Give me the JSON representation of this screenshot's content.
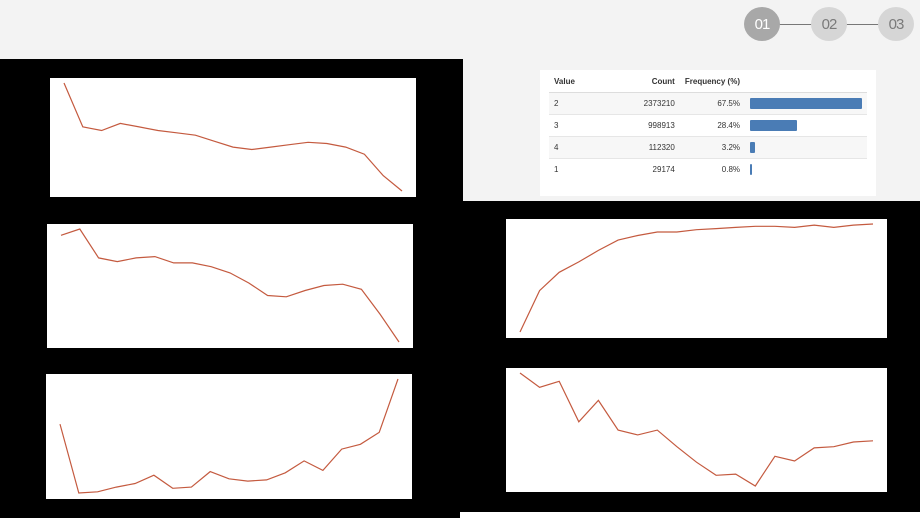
{
  "stepper": {
    "steps": [
      {
        "label": "01",
        "active": true
      },
      {
        "label": "02",
        "active": false
      },
      {
        "label": "03",
        "active": false
      }
    ]
  },
  "frequency_table": {
    "headers": [
      "Value",
      "Count",
      "Frequency (%)"
    ],
    "rows": [
      {
        "value": "2",
        "count": "2373210",
        "frequency": "67.5%",
        "fraction": 0.675
      },
      {
        "value": "3",
        "count": "998913",
        "frequency": "28.4%",
        "fraction": 0.284
      },
      {
        "value": "4",
        "count": "112320",
        "frequency": "3.2%",
        "fraction": 0.032
      },
      {
        "value": "1",
        "count": "29174",
        "frequency": "0.8%",
        "fraction": 0.008
      }
    ],
    "bar_color": "#4a7cb5"
  },
  "charts": {
    "line_color": "#c45a3f",
    "chart_data": [
      {
        "type": "line",
        "values": [
          100,
          63,
          60,
          66,
          63,
          60,
          58,
          56,
          51,
          46,
          44,
          46,
          48,
          50,
          49,
          46,
          40,
          22,
          9
        ]
      },
      {
        "type": "line",
        "values": [
          88,
          93,
          70,
          67,
          70,
          71,
          66,
          66,
          63,
          58,
          50,
          40,
          39,
          44,
          48,
          49,
          45,
          25,
          3
        ]
      },
      {
        "type": "line",
        "values": [
          62,
          4,
          5,
          9,
          12,
          19,
          8,
          9,
          22,
          16,
          14,
          15,
          21,
          31,
          23,
          41,
          45,
          55,
          100
        ]
      },
      {
        "type": "line",
        "values": [
          6,
          42,
          58,
          67,
          77,
          86,
          90,
          93,
          93,
          95,
          96,
          97,
          98,
          98,
          97,
          99,
          97,
          99,
          100
        ]
      },
      {
        "type": "line",
        "values": [
          100,
          88,
          93,
          59,
          77,
          52,
          48,
          52,
          38,
          25,
          14,
          15,
          5,
          30,
          26,
          37,
          38,
          42,
          43
        ]
      }
    ]
  }
}
